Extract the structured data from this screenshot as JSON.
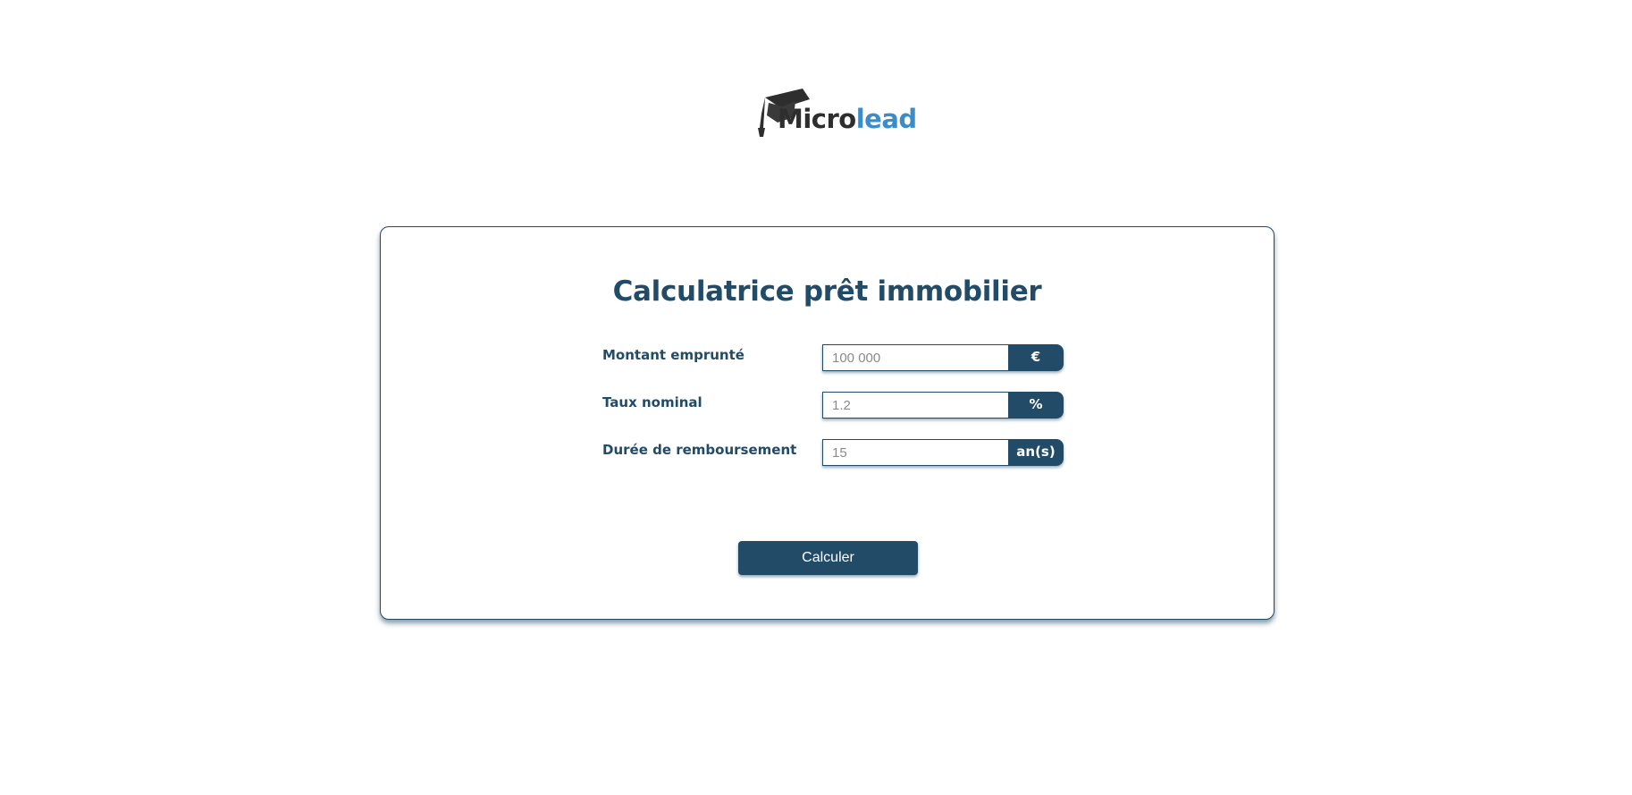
{
  "brand": {
    "logo_text_part1": "Micro",
    "logo_text_part2": "lead",
    "logo_icon": "graduation-cap-icon",
    "colors": {
      "primary": "#224b68",
      "logo_dark": "#2e2e2e",
      "logo_accent": "#3a8dc8"
    }
  },
  "calculator": {
    "title": "Calculatrice prêt immobilier",
    "fields": [
      {
        "label": "Montant emprunté",
        "placeholder": "100 000",
        "unit": "€"
      },
      {
        "label": "Taux nominal",
        "placeholder": "1.2",
        "unit": "%"
      },
      {
        "label": "Durée de remboursement",
        "placeholder": "15",
        "unit": "an(s)"
      }
    ],
    "submit_label": "Calculer"
  }
}
